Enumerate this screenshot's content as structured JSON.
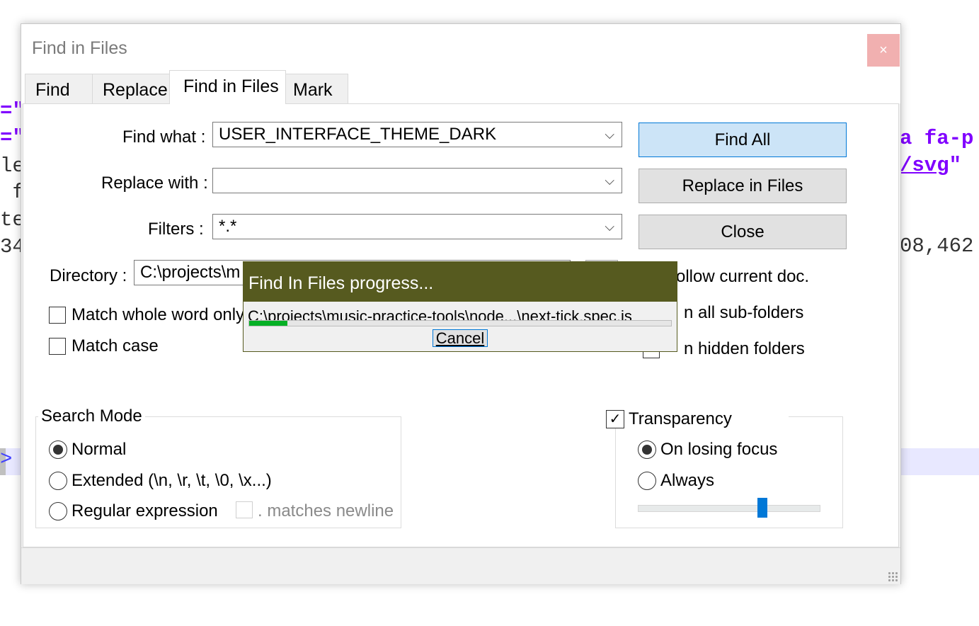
{
  "background_editor": {
    "left_frags": [
      "=\"",
      "=\"",
      "le",
      " f",
      "te",
      "34"
    ],
    "right_frag_1": "a fa-p",
    "right_frag_2": "/svg",
    "right_frag_2_quote": "\"",
    "right_frag_3": "08,462",
    "marker": ">"
  },
  "dialog": {
    "title": "Find in Files",
    "close_glyph": "×",
    "tabs": [
      {
        "label": "Find",
        "active": false
      },
      {
        "label": "Replace",
        "active": false
      },
      {
        "label": "Find in Files",
        "active": true
      },
      {
        "label": "Mark",
        "active": false
      }
    ],
    "find_what_label": "Find what :",
    "find_what_value": "USER_INTERFACE_THEME_DARK",
    "replace_with_label": "Replace with :",
    "replace_with_value": "",
    "filters_label": "Filters :",
    "filters_value": "*.*",
    "directory_label": "Directory :",
    "directory_value": "C:\\projects\\m",
    "dropdown_arrow": "⌵",
    "buttons": {
      "find_all": "Find All",
      "replace_in_files": "Replace in Files",
      "close": "Close"
    },
    "options": {
      "follow_current_doc": "ollow current doc.",
      "in_all_sub_folders": "n all sub-folders",
      "in_hidden_folders": "n hidden folders",
      "match_whole_word": "Match whole word only",
      "match_case": "Match case"
    },
    "search_mode": {
      "title": "Search Mode",
      "normal": "Normal",
      "extended": "Extended (\\n, \\r, \\t, \\0, \\x...)",
      "regex": "Regular expression",
      "matches_newline": ". matches newline",
      "selected": "normal"
    },
    "transparency": {
      "title": "Transparency",
      "checked": true,
      "check_glyph": "✓",
      "on_losing_focus": "On losing focus",
      "always": "Always",
      "selected": "on_losing_focus",
      "slider_level": 0.7
    }
  },
  "progress": {
    "title": "Find In Files progress...",
    "current_path": "C:\\projects\\music-practice-tools\\node...\\next-tick.spec.js",
    "fraction": 0.09,
    "cancel_label": "Cancel"
  }
}
